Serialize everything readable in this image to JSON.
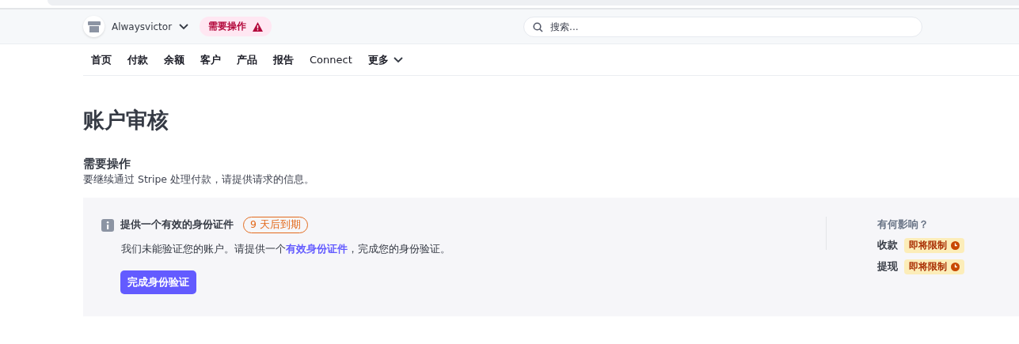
{
  "header": {
    "account": "Alwaysvictor",
    "alert_badge": "需要操作",
    "search": {
      "placeholder": "搜索..."
    }
  },
  "nav": {
    "items": [
      {
        "label": "首页"
      },
      {
        "label": "付款"
      },
      {
        "label": "余额"
      },
      {
        "label": "客户"
      },
      {
        "label": "产品"
      },
      {
        "label": "报告"
      },
      {
        "label": "Connect"
      },
      {
        "label": "更多",
        "kind": "dropdown"
      }
    ]
  },
  "page": {
    "title": "账户审核",
    "section_title": "需要操作",
    "section_text": "要继续通过 Stripe 处理付款，请提供请求的信息。"
  },
  "task": {
    "title": "提供一个有效的身份证件",
    "deadline": "9 天后到期",
    "text_before": "我们未能验证您的账户。请提供一个",
    "link": "有效身份证件",
    "text_after": "，完成您的身份验证。",
    "button": "完成身份验证",
    "impact": {
      "title": "有何影响？",
      "rows": [
        {
          "label": "收款",
          "status": "即将限制"
        },
        {
          "label": "提现",
          "status": "即将限制"
        }
      ]
    }
  }
}
